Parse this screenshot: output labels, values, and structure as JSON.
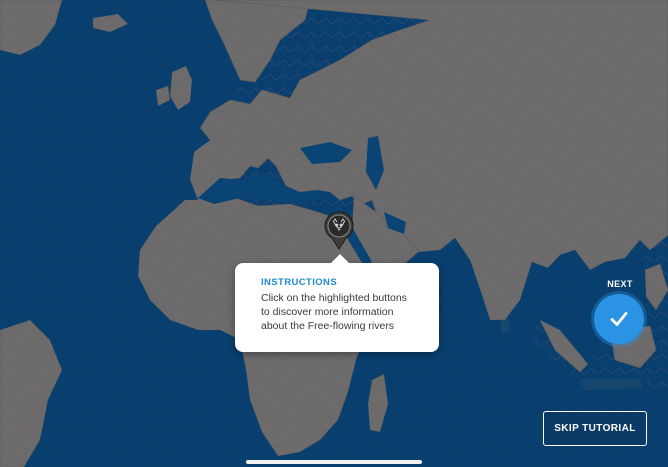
{
  "colors": {
    "ocean": "#083f6e",
    "land": "#6b6b6b",
    "rivers": "#b06a78",
    "accent": "#2b93e3",
    "tooltip_title": "#1f8bd0"
  },
  "map": {
    "content": "world map of Free-flowing rivers (Europe, Africa, Asia)",
    "pin_icon": "leopard-icon"
  },
  "tooltip": {
    "title": "INSTRUCTIONS",
    "line1": "Click on the highlighted buttons",
    "line2": "to discover more information",
    "line3": "about the Free-flowing rivers"
  },
  "next": {
    "label": "NEXT",
    "icon": "checkmark-icon"
  },
  "skip": {
    "label": "SKIP TUTORIAL"
  }
}
